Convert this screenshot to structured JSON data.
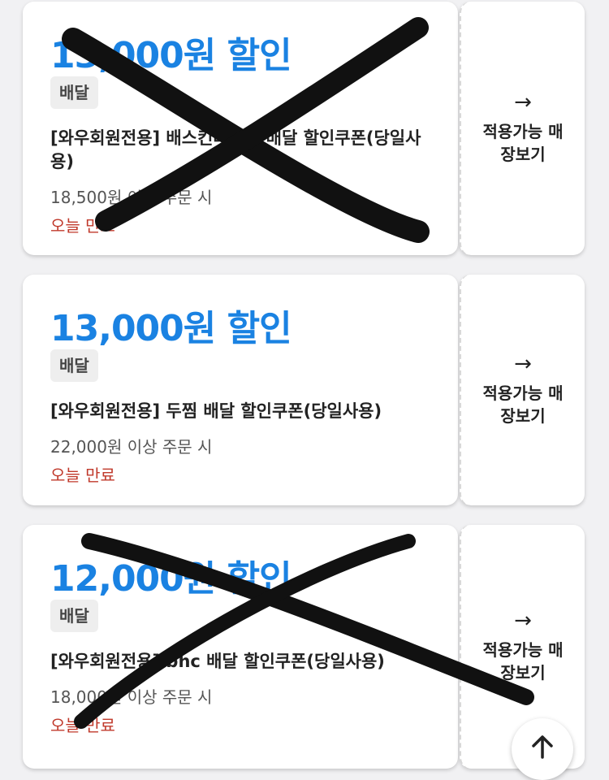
{
  "coupons": [
    {
      "amount": "13,000원 할인",
      "badge": "배달",
      "title": "[와우회원전용] 배스킨라빈스 배달 할인쿠폰(당일사용)",
      "condition": "18,500원 이상 주문 시",
      "expiry": "오늘 만료",
      "store_button": "적용가능 매장보기",
      "crossed_out": true
    },
    {
      "amount": "13,000원 할인",
      "badge": "배달",
      "title": "[와우회원전용] 두찜 배달 할인쿠폰(당일사용)",
      "condition": "22,000원 이상 주문 시",
      "expiry": "오늘 만료",
      "store_button": "적용가능 매장보기",
      "crossed_out": false
    },
    {
      "amount": "12,000원 할인",
      "badge": "배달",
      "title": "[와우회원전용] bhc 배달 할인쿠폰(당일사용)",
      "condition": "18,000원 이상 주문 시",
      "expiry": "오늘 만료",
      "store_button": "적용가능 매장보기",
      "crossed_out": true
    }
  ],
  "icons": {
    "store_arrow": "arrow-right-icon",
    "scroll_top": "arrow-up-icon"
  },
  "colors": {
    "amount": "#1a82e2",
    "expiry": "#c0392b",
    "scrawl": "#111111"
  }
}
